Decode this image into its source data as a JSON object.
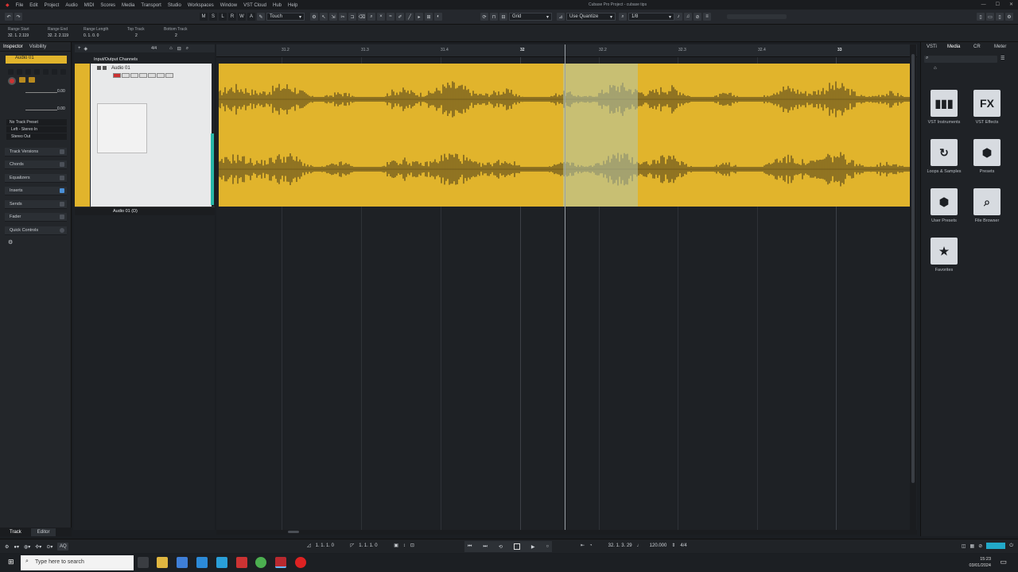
{
  "app": {
    "title": "Cubase Pro Project - cubase tips"
  },
  "menu": [
    "File",
    "Edit",
    "Project",
    "Audio",
    "MIDI",
    "Scores",
    "Media",
    "Transport",
    "Studio",
    "Workspaces",
    "Window",
    "VST Cloud",
    "Hub",
    "Help"
  ],
  "toolbar": {
    "mode_buttons": [
      "M",
      "S",
      "L",
      "R",
      "W",
      "A"
    ],
    "automation_mode": "Touch",
    "snap_type": "Grid",
    "quantize_mode": "Use Quantize",
    "quantize_value": "1/8"
  },
  "infoline": [
    {
      "label": "Range Start",
      "value": "32. 1. 2.119"
    },
    {
      "label": "Range End",
      "value": "32. 2. 2.119"
    },
    {
      "label": "Range Length",
      "value": "0. 1. 0.  0"
    },
    {
      "label": "Top Track",
      "value": "2"
    },
    {
      "label": "Bottom Track",
      "value": "2"
    }
  ],
  "inspector": {
    "tabs": [
      "Inspector",
      "Visibility"
    ],
    "track_name": "Audio 01",
    "volume": "0.00",
    "pan": "0.00",
    "no_track_preset": "No Track Preset",
    "input": "Left - Stereo In",
    "output": "Stereo Out",
    "sections": [
      "Track Versions",
      "Chords",
      "Equalizers",
      "Inserts",
      "Sends",
      "Fader",
      "Quick Controls"
    ]
  },
  "tracklist": {
    "signature": "4/4",
    "folder": "Input/Output Channels",
    "track": "Audio 01",
    "lane": "Audio 01 (D)"
  },
  "ruler": {
    "labels": [
      "31.2",
      "31.3",
      "31.4",
      "32",
      "32.2",
      "32.3",
      "32.4",
      "33"
    ]
  },
  "rightzone": {
    "tabs": [
      "VSTi",
      "Media",
      "CR",
      "Meter"
    ],
    "items": [
      {
        "label": "VST Instruments",
        "glyph": "▮▮▮"
      },
      {
        "label": "VST Effects",
        "glyph": "FX"
      },
      {
        "label": "Loops & Samples",
        "glyph": "↻"
      },
      {
        "label": "Presets",
        "glyph": "⬢"
      },
      {
        "label": "User Presets",
        "glyph": "⬢"
      },
      {
        "label": "File Browser",
        "glyph": "⌕"
      },
      {
        "label": "Favorites",
        "glyph": "★"
      }
    ]
  },
  "lowertabs": [
    "Track",
    "Editor"
  ],
  "transport": {
    "left_locator": "1. 1. 1.  0",
    "right_locator": "1. 1. 1.  0",
    "position": "32. 1. 3. 29",
    "tempo": "120.000",
    "signature": "4/4"
  },
  "taskbar": {
    "search_placeholder": "Type here to search",
    "time": "15:23",
    "date": "03/01/2024"
  },
  "colors": {
    "event": "#e1b42c",
    "waveform": "#7c6320",
    "selection": "#b4c8af",
    "track_color": "#e1b42c"
  }
}
